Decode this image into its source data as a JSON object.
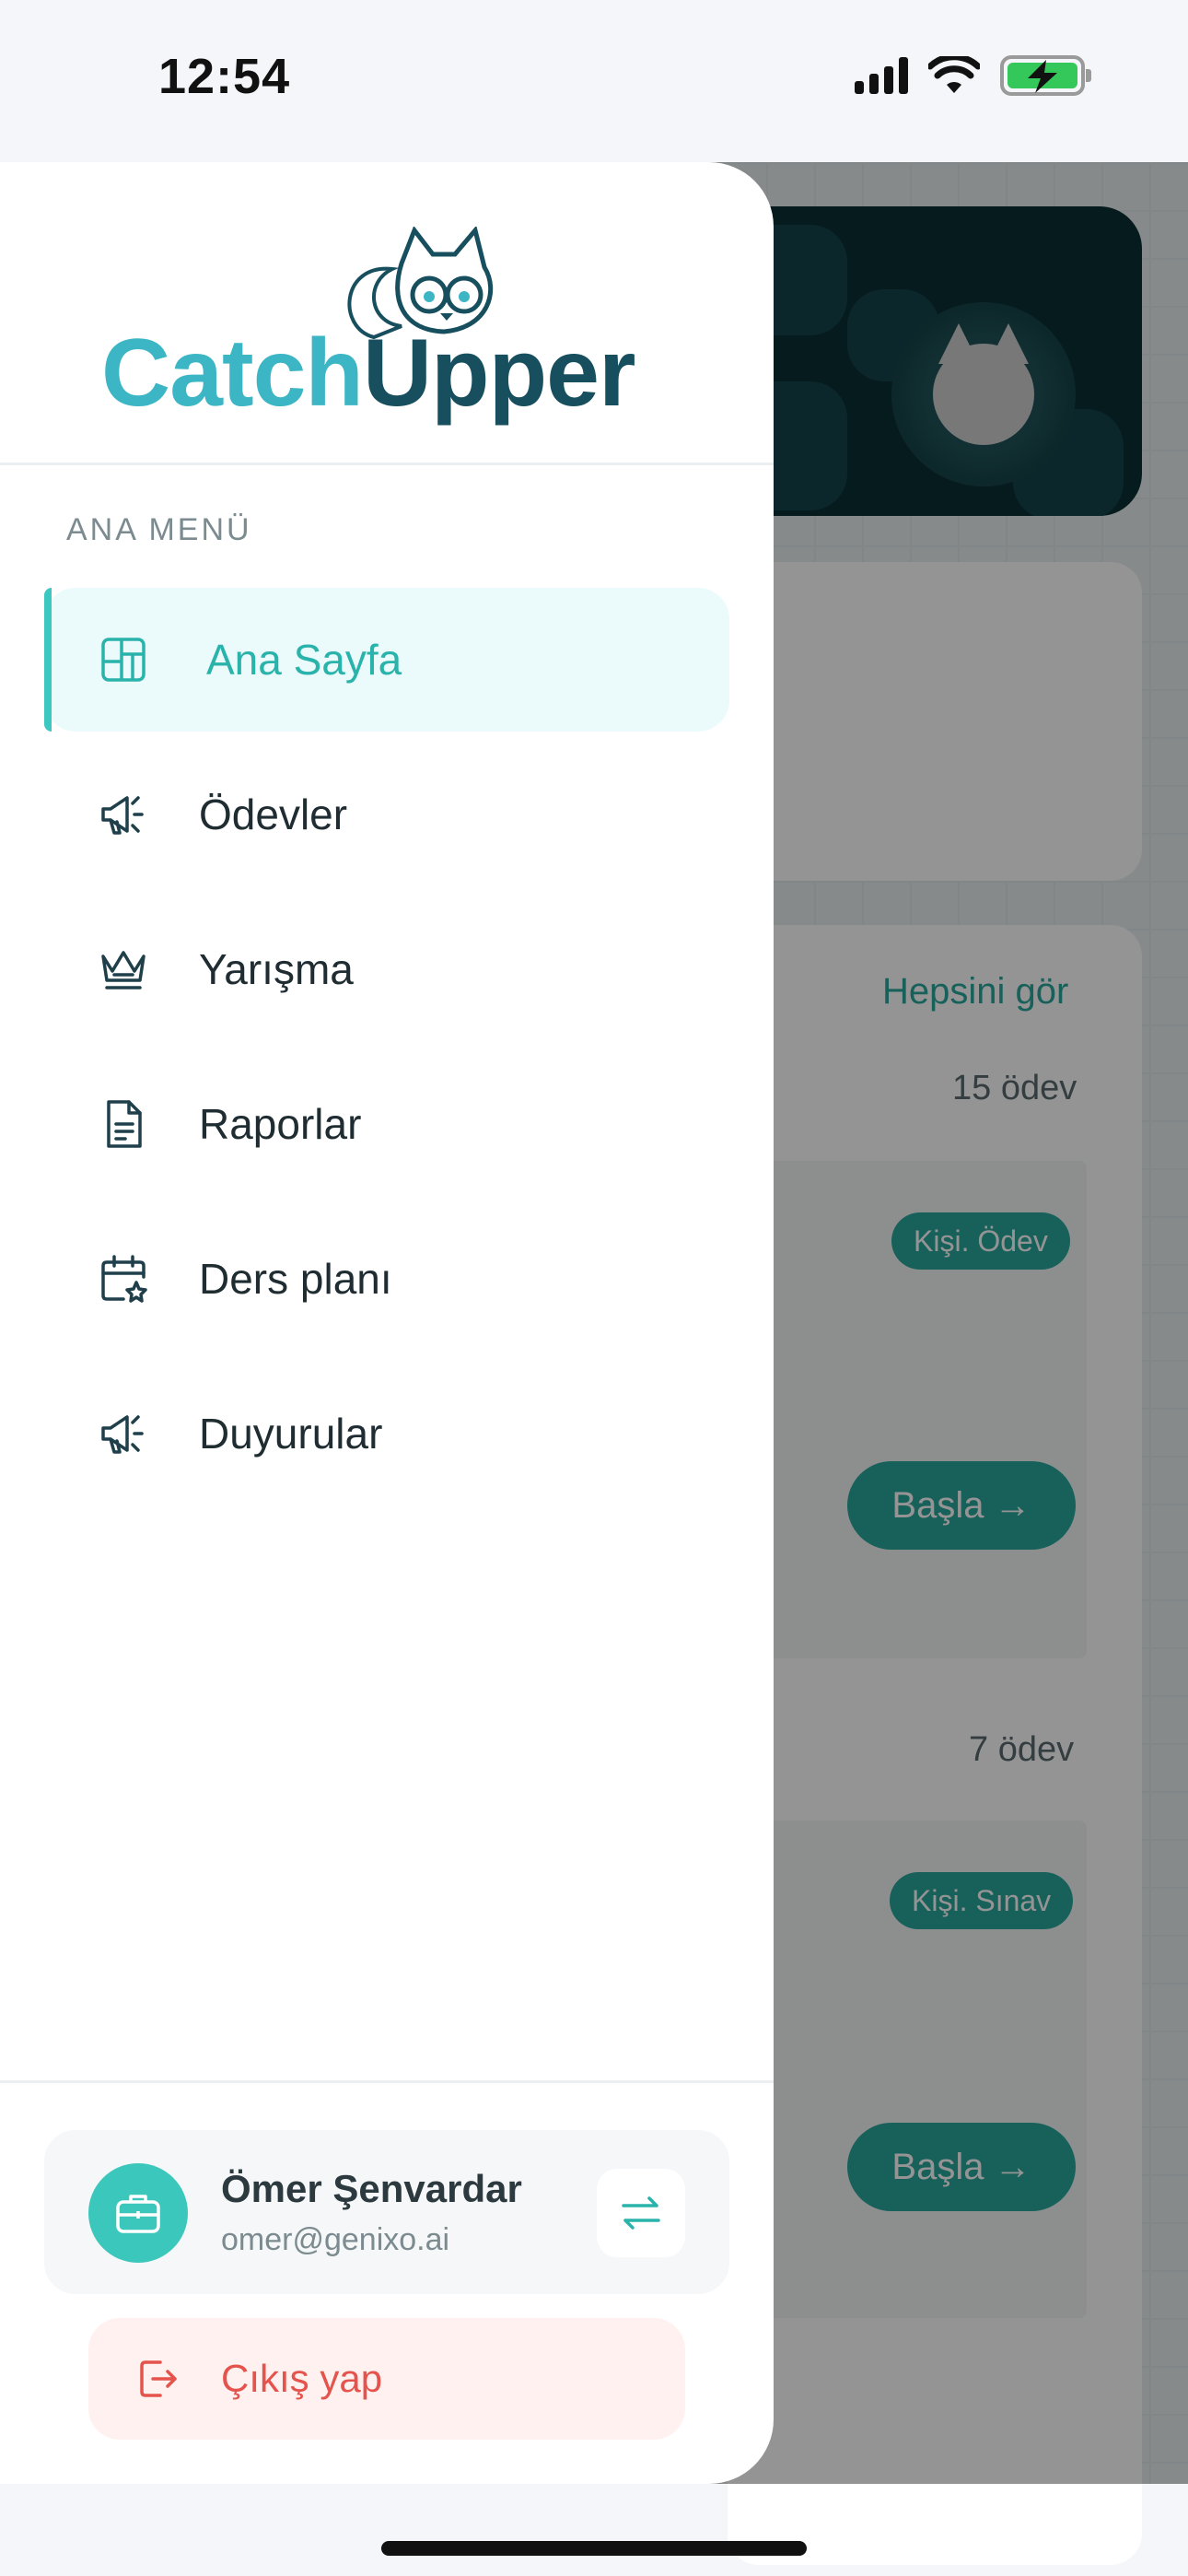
{
  "status_bar": {
    "time": "12:54",
    "icons": [
      "signal-icon",
      "wifi-icon",
      "battery-charging-icon"
    ]
  },
  "drawer": {
    "logo": {
      "part1": "Catch",
      "part2": "Upper"
    },
    "section_label": "ANA MENÜ",
    "menu": [
      {
        "label": "Ana Sayfa",
        "icon": "dashboard-icon",
        "active": true
      },
      {
        "label": "Ödevler",
        "icon": "megaphone-icon",
        "active": false
      },
      {
        "label": "Yarışma",
        "icon": "crown-icon",
        "active": false
      },
      {
        "label": "Raporlar",
        "icon": "document-icon",
        "active": false
      },
      {
        "label": "Ders planı",
        "icon": "calendar-star-icon",
        "active": false
      },
      {
        "label": "Duyurular",
        "icon": "megaphone-icon",
        "active": false
      }
    ],
    "user": {
      "name": "Ömer Şenvardar",
      "email": "omer@genixo.ai"
    },
    "logout_label": "Çıkış yap"
  },
  "background": {
    "see_all": "Hepsini gör",
    "groups": [
      {
        "count": "15 ödev",
        "badge": "Kişi. Ödev",
        "button": "Başla →"
      },
      {
        "count": "7 ödev",
        "badge": "Kişi. Sınav",
        "button": "Başla →"
      }
    ]
  },
  "colors": {
    "accent": "#2ab3ab",
    "active_bg": "#ebfbfb",
    "logout": "#e5544c",
    "logo_light": "#3cb6c4",
    "logo_dark": "#174f5e"
  }
}
